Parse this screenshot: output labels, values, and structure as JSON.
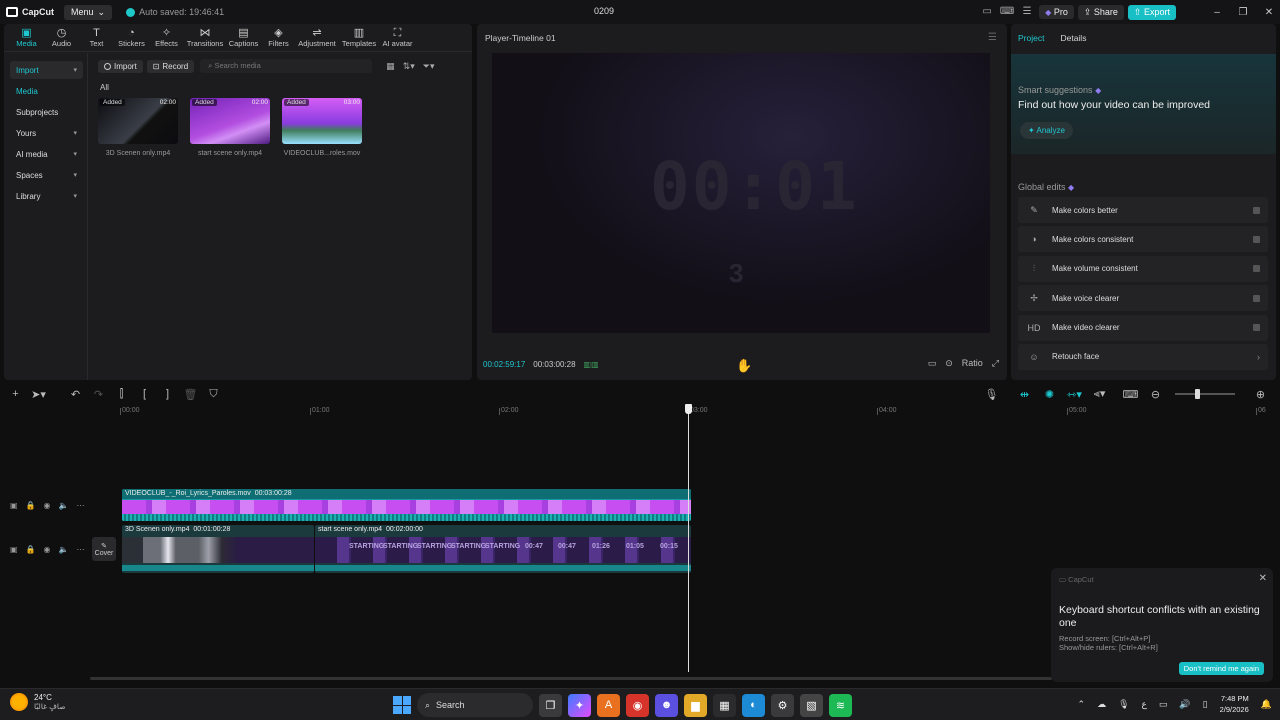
{
  "app": {
    "logo": "CapCut",
    "menu_label": "Menu",
    "autosave": "Auto saved: 19:46:41",
    "project_name": "0209",
    "pro_label": "Pro",
    "share_label": "Share",
    "export_label": "Export"
  },
  "tools": [
    {
      "icon": "media-icon",
      "label": "Media"
    },
    {
      "icon": "audio-icon",
      "label": "Audio"
    },
    {
      "icon": "text-icon",
      "label": "Text"
    },
    {
      "icon": "stickers-icon",
      "label": "Stickers"
    },
    {
      "icon": "effects-icon",
      "label": "Effects"
    },
    {
      "icon": "transitions-icon",
      "label": "Transitions"
    },
    {
      "icon": "captions-icon",
      "label": "Captions"
    },
    {
      "icon": "filters-icon",
      "label": "Filters"
    },
    {
      "icon": "adjustment-icon",
      "label": "Adjustment"
    },
    {
      "icon": "templates-icon",
      "label": "Templates"
    },
    {
      "icon": "ai-avatar-icon",
      "label": "AI avatar"
    }
  ],
  "sidebar": [
    {
      "label": "Import"
    },
    {
      "label": "Media"
    },
    {
      "label": "Subprojects"
    },
    {
      "label": "Yours"
    },
    {
      "label": "AI media"
    },
    {
      "label": "Spaces"
    },
    {
      "label": "Library"
    }
  ],
  "media": {
    "import_label": "Import",
    "record_label": "Record",
    "search_placeholder": "Search media",
    "filter_all": "All",
    "items": [
      {
        "badge": "Added",
        "duration": "02:00",
        "name": "3D Scenen only.mp4"
      },
      {
        "badge": "Added",
        "duration": "02:00",
        "name": "start scene only.mp4"
      },
      {
        "badge": "Added",
        "duration": "03:00",
        "name": "VIDEOCLUB...roles.mov"
      }
    ]
  },
  "player": {
    "title": "Player-Timeline 01",
    "preview_timecode": "00:01",
    "preview_sub": "3",
    "current_time": "00:02:59:17",
    "total_time": "00:03:00:28",
    "ratio_label": "Ratio"
  },
  "right": {
    "tab_project": "Project",
    "tab_details": "Details",
    "smart_label": "Smart suggestions",
    "smart_title": "Find out how your video can be improved",
    "analyze_label": "Analyze",
    "global_label": "Global edits",
    "edits": [
      {
        "icon": "wand-icon",
        "label": "Make colors better"
      },
      {
        "icon": "palette-icon",
        "label": "Make colors consistent"
      },
      {
        "icon": "equalizer-icon",
        "label": "Make volume consistent"
      },
      {
        "icon": "voice-icon",
        "label": "Make voice clearer"
      },
      {
        "icon": "hd-icon",
        "label": "Make video clearer",
        "icon_text": "HD"
      },
      {
        "icon": "face-icon",
        "label": "Retouch face"
      }
    ]
  },
  "timeline": {
    "ruler": [
      "00:00",
      "01:00",
      "02:00",
      "03:00",
      "04:00",
      "05:00",
      "06"
    ],
    "cover_label": "Cover",
    "clip_top_label": "VIDEOCLUB_-_Roi_Lyrics_Paroles.mov",
    "clip_top_duration": "00:03:00:28",
    "clip_a_label": "3D Scenen only.mp4",
    "clip_a_duration": "00:01:00:28",
    "clip_b_label": "start scene only.mp4",
    "clip_b_duration": "00:02:00:00",
    "frame_texts": [
      "STARTING",
      "STARTING",
      "STARTING",
      "STARTING",
      "STARTING",
      "00:47",
      "00:47",
      "01:26",
      "01:05",
      "00:15"
    ]
  },
  "toast": {
    "app": "CapCut",
    "title": "Keyboard shortcut conflicts with an existing one",
    "line1": "Record screen: [Ctrl+Alt+P]",
    "line2": "Show/hide rulers: [Ctrl+Alt+R]",
    "button": "Don't remind me again"
  },
  "taskbar": {
    "temp": "24°C",
    "weather_text": "صافٍ غالبًا",
    "search_label": "Search",
    "lang": "ع",
    "time": "7:48 PM",
    "date": "2/9/2026"
  }
}
